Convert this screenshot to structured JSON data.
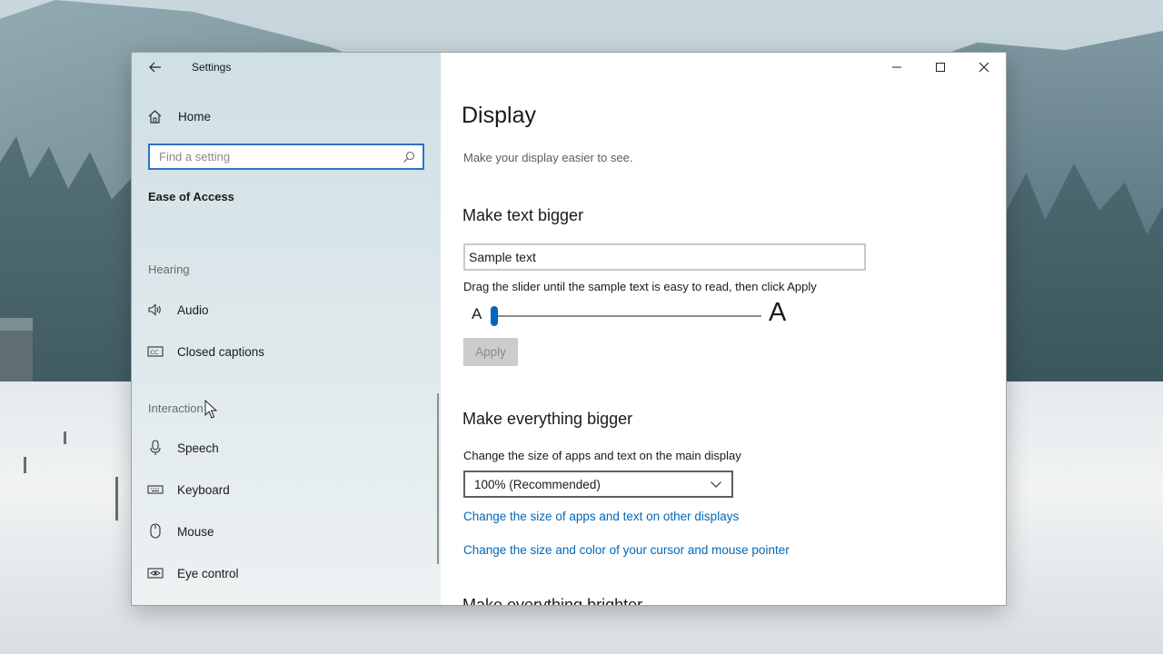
{
  "window": {
    "title": "Settings"
  },
  "sidebar": {
    "home_label": "Home",
    "search_placeholder": "Find a setting",
    "section_title": "Ease of Access",
    "groups": [
      {
        "header": "Hearing",
        "items": [
          {
            "label": "Audio",
            "icon": "speaker-icon"
          },
          {
            "label": "Closed captions",
            "icon": "closed-captions-icon"
          }
        ]
      },
      {
        "header": "Interaction",
        "items": [
          {
            "label": "Speech",
            "icon": "microphone-icon"
          },
          {
            "label": "Keyboard",
            "icon": "keyboard-icon"
          },
          {
            "label": "Mouse",
            "icon": "mouse-icon"
          },
          {
            "label": "Eye control",
            "icon": "eye-control-icon"
          }
        ]
      }
    ]
  },
  "main": {
    "title": "Display",
    "description": "Make your display easier to see.",
    "text_bigger": {
      "heading": "Make text bigger",
      "sample_text": "Sample text",
      "hint": "Drag the slider until the sample text is easy to read, then click Apply",
      "small_glyph": "A",
      "large_glyph": "A",
      "slider_value": 0.0,
      "apply_label": "Apply"
    },
    "everything_bigger": {
      "heading": "Make everything bigger",
      "description": "Change the size of apps and text on the main display",
      "scale_value": "100% (Recommended)",
      "link_other_displays": "Change the size of apps and text on other displays",
      "link_cursor": "Change the size and color of your cursor and mouse pointer"
    },
    "cut_off_heading": "Make everything brighter"
  },
  "colors": {
    "accent": "#0067c0",
    "link": "#0067b8",
    "search_border": "#2a72c8"
  }
}
